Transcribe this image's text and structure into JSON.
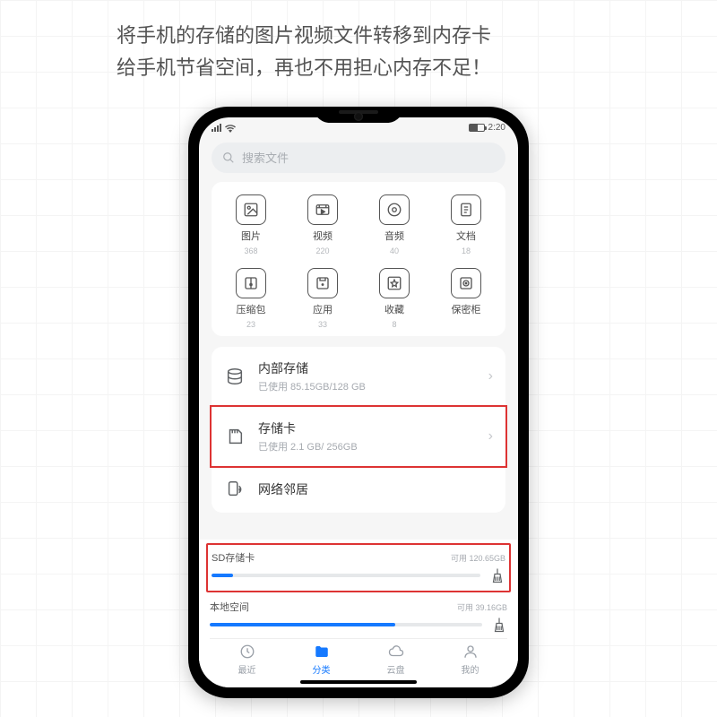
{
  "headline": {
    "line1": "将手机的存储的图片视频文件转移到内存卡",
    "line2": "给手机节省空间，再也不用担心内存不足！"
  },
  "status": {
    "time": "2:20"
  },
  "search": {
    "placeholder": "搜索文件"
  },
  "categories": [
    {
      "label": "图片",
      "count": "368",
      "icon": "image"
    },
    {
      "label": "视频",
      "count": "220",
      "icon": "video"
    },
    {
      "label": "音频",
      "count": "40",
      "icon": "audio"
    },
    {
      "label": "文档",
      "count": "18",
      "icon": "doc"
    },
    {
      "label": "压缩包",
      "count": "23",
      "icon": "zip"
    },
    {
      "label": "应用",
      "count": "33",
      "icon": "app"
    },
    {
      "label": "收藏",
      "count": "8",
      "icon": "fav"
    },
    {
      "label": "保密柜",
      "count": "",
      "icon": "safe"
    }
  ],
  "storage": {
    "internal": {
      "title": "内部存储",
      "sub": "已使用 85.15GB/128 GB"
    },
    "sd": {
      "title": "存储卡",
      "sub": "已使用 2.1 GB/ 256GB"
    },
    "lan": {
      "title": "网络邻居"
    }
  },
  "usage": {
    "sd": {
      "title": "SD存储卡",
      "avail": "可用 120.65GB",
      "pct": 8
    },
    "local": {
      "title": "本地空间",
      "avail": "可用 39.16GB",
      "pct": 68
    }
  },
  "tabs": [
    {
      "label": "最近",
      "icon": "clock"
    },
    {
      "label": "分类",
      "icon": "folder",
      "active": true
    },
    {
      "label": "云盘",
      "icon": "cloud"
    },
    {
      "label": "我的",
      "icon": "person"
    }
  ]
}
